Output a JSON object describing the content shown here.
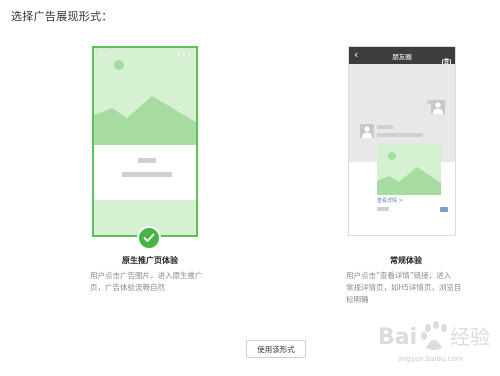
{
  "page": {
    "heading": "选择广告展现形式："
  },
  "options": [
    {
      "title": "原生推广页体验",
      "description_lines": [
        "用户点击广告图片，进入原生推广",
        "页，广告体验流畅自然"
      ],
      "selected": true
    },
    {
      "title": "常规体验",
      "description_lines": [
        "用户点击“查看详情”链接，进入",
        "常规详情页，如H5详情页，浏览目",
        "标明确"
      ],
      "selected": false,
      "preview": {
        "nav_title": "朋友圈",
        "link_label": "查看详情 >"
      }
    }
  ],
  "actions": {
    "use_button": "使用该形式"
  },
  "watermark": {
    "text": "jingyan.baidu.com"
  },
  "colors": {
    "accent_green": "#47b545",
    "preview_green_light": "#d6f0d2",
    "preview_green_mid": "#a6dca0"
  },
  "icons": {
    "selected_check": "check-icon",
    "preview_camera": "camera-icon",
    "preview_back": "back-arrow-icon",
    "preview_avatar": "user-avatar-icon"
  }
}
